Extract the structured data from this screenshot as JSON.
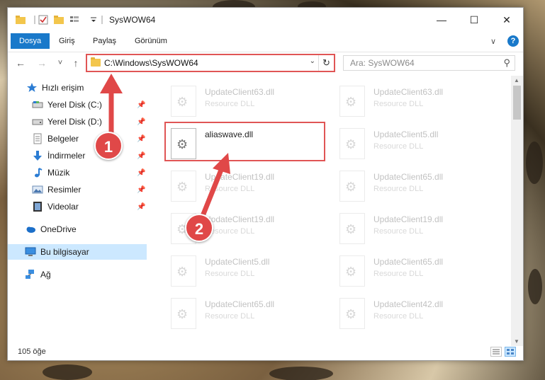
{
  "window": {
    "title": "SysWOW64",
    "minimize_glyph": "—",
    "maximize_glyph": "☐",
    "close_glyph": "✕"
  },
  "ribbon": {
    "tabs": [
      {
        "label": "Dosya",
        "active": true
      },
      {
        "label": "Giriş"
      },
      {
        "label": "Paylaş"
      },
      {
        "label": "Görünüm"
      }
    ],
    "expand_glyph": "∨",
    "help_glyph": "?"
  },
  "navigation": {
    "back_glyph": "←",
    "forward_glyph": "→",
    "recent_glyph": "˅",
    "up_glyph": "↑",
    "address": "C:\\Windows\\SysWOW64",
    "address_dropdown_glyph": "⌄",
    "refresh_glyph": "↻",
    "search_placeholder": "Ara: SysWOW64",
    "search_glyph": "⚲"
  },
  "sidebar": {
    "items": [
      {
        "label": "Hızlı erişim",
        "icon": "star-icon",
        "pinned": false
      },
      {
        "label": "Yerel Disk (C:)",
        "icon": "drive-icon",
        "pinned": true
      },
      {
        "label": "Yerel Disk (D:)",
        "icon": "drive-icon",
        "pinned": true
      },
      {
        "label": "Belgeler",
        "icon": "documents-icon",
        "pinned": true
      },
      {
        "label": "İndirmeler",
        "icon": "download-icon",
        "pinned": true
      },
      {
        "label": "Müzik",
        "icon": "music-icon",
        "pinned": true
      },
      {
        "label": "Resimler",
        "icon": "pictures-icon",
        "pinned": true
      },
      {
        "label": "Videolar",
        "icon": "video-icon",
        "pinned": true
      },
      {
        "label": "OneDrive",
        "icon": "cloud-icon",
        "pinned": false
      },
      {
        "label": "Bu bilgisayar",
        "icon": "computer-icon",
        "pinned": false,
        "selected": true
      },
      {
        "label": "Ağ",
        "icon": "network-icon",
        "pinned": false
      }
    ],
    "pin_glyph": "📌"
  },
  "files": {
    "highlighted": {
      "name": "aliaswave.dll",
      "type": ""
    },
    "background_tiles": [
      {
        "name": "UpdateClient63.dll",
        "type": "Resource DLL"
      },
      {
        "name": "UpdateClient63.dll",
        "type": "Resource DLL"
      },
      {
        "name": "UpdateClient5.dll",
        "type": "Resource DLL"
      },
      {
        "name": "UpdateClient19.dll",
        "type": "Resource DLL"
      },
      {
        "name": "UpdateClient65.dll",
        "type": "Resource DLL"
      },
      {
        "name": "UpdateClient19.dll",
        "type": "Resource DLL"
      },
      {
        "name": "UpdateClient19.dll",
        "type": "Resource DLL"
      },
      {
        "name": "UpdateClient5.dll",
        "type": "Resource DLL"
      },
      {
        "name": "UpdateClient65.dll",
        "type": "Resource DLL"
      },
      {
        "name": "UpdateClient65.dll",
        "type": "Resource DLL"
      },
      {
        "name": "UpdateClient42.dll",
        "type": "Resource DLL"
      }
    ]
  },
  "status": {
    "item_count": "105 öğe"
  },
  "annotations": {
    "badge1": "1",
    "badge2": "2",
    "color": "#e04848"
  }
}
